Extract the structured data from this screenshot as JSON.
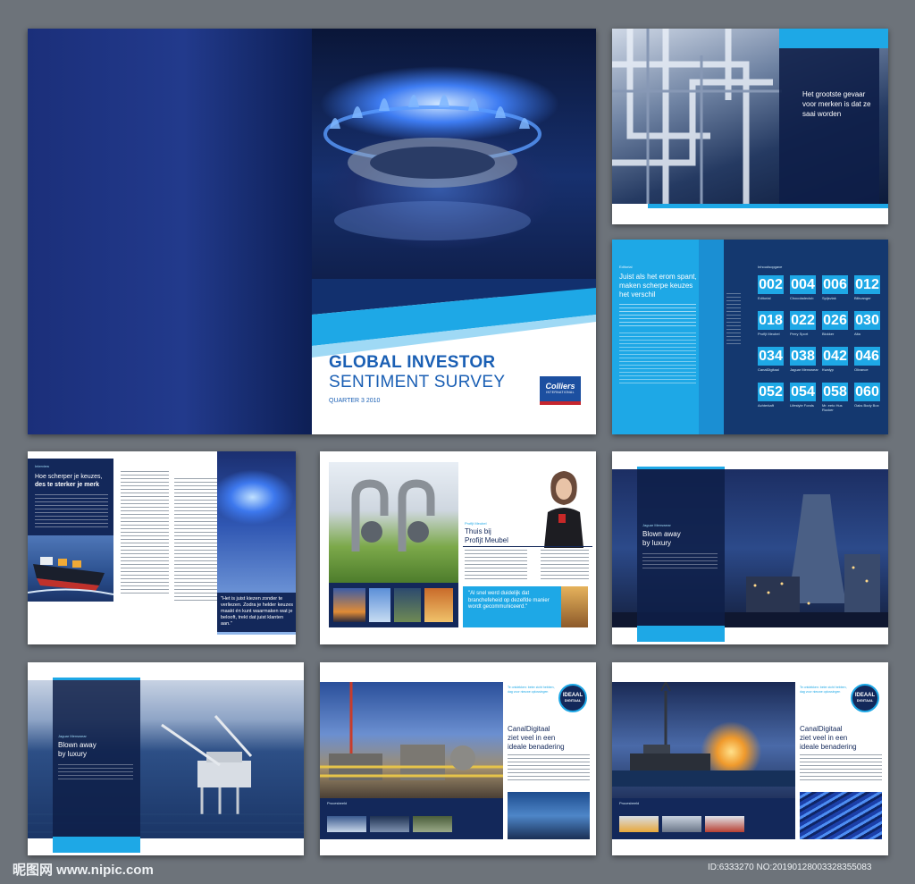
{
  "cover": {
    "title_line1": "GLOBAL INVESTOR",
    "title_line2": "SENTIMENT SURVEY",
    "quarter": "QUARTER 3 2010",
    "logo_line1": "Colliers",
    "logo_line2": "INTERNATIONAL"
  },
  "page_pipes": {
    "quote": "Het grootste gevaar voor merken is dat ze saai worden"
  },
  "page_index": {
    "intro_label": "Editorial",
    "intro_heading": "Juist als het erom spant, maken scherpe keuzes het verschil",
    "toc_label": "Inhoudsopgave",
    "toc_tiles": [
      {
        "number": "002",
        "caption": "Editorial"
      },
      {
        "number": "004",
        "caption": "Chocoladeclub"
      },
      {
        "number": "006",
        "caption": "Spijsvlak"
      },
      {
        "number": "012",
        "caption": "Blikvanger"
      },
      {
        "number": "018",
        "caption": "Profijt Meubel"
      },
      {
        "number": "022",
        "caption": "Perry Sport"
      },
      {
        "number": "026",
        "caption": "Blokker"
      },
      {
        "number": "030",
        "caption": "Alta"
      },
      {
        "number": "034",
        "caption": "CanalDigitaal"
      },
      {
        "number": "038",
        "caption": "Jaguar Menswear"
      },
      {
        "number": "042",
        "caption": "Kwalyp"
      },
      {
        "number": "046",
        "caption": "Olivance"
      },
      {
        "number": "052",
        "caption": "Achterkaft"
      },
      {
        "number": "054",
        "caption": "Lifestyle Fonds"
      },
      {
        "number": "058",
        "caption": "Mr. eeto Hus Rucker"
      },
      {
        "number": "060",
        "caption": "Oaks Body Box"
      }
    ]
  },
  "page_keuzes": {
    "label": "Interview",
    "heading_line1": "Hoe scherper je keuzes,",
    "heading_line2": "des te sterker je merk",
    "quote": "\"Het is juist kiezen zonder te verliezen. Zodra je helder keuzes maakt én kunt waarmaken wat je belooft, trekt dat juist klanten aan.\""
  },
  "page_profijt": {
    "label": "Profijt Meubel",
    "heading_line1": "Thuis bij",
    "heading_line2": "Profijt Meubel",
    "quote": "\"Al snel werd duidelijk dat branchefeheid op dezelfde manier wordt gecommuniceerd.\""
  },
  "page_blown1": {
    "label": "Jaguar Menswear",
    "heading_line1": "Blown away",
    "heading_line2": "by luxury"
  },
  "page_blown2": {
    "label": "Jaguar Menswear",
    "heading_line1": "Blown away",
    "heading_line2": "by luxury"
  },
  "page_canal1": {
    "kicker": "Te ontdekken: beter zicht hebben, dag voor nieuwe oplossingen",
    "badge_line1": "IDEAAL",
    "badge_line2": "DIGITAAL",
    "heading_line1": "CanalDigitaal",
    "heading_line2": "ziet veel in een",
    "heading_line3": "ideale benadering",
    "caption": "Procesbeeld"
  },
  "page_canal2": {
    "kicker": "Te ontdekken: beter zicht hebben, dag voor nieuwe oplossingen",
    "badge_line1": "IDEAAL",
    "badge_line2": "DIGITAAL",
    "heading_line1": "CanalDigitaal",
    "heading_line2": "ziet veel in een",
    "heading_line3": "ideale benadering",
    "caption": "Procesbeeld"
  },
  "watermark": {
    "site": "昵图网 www.nipic.com",
    "id": "ID:6333270 NO:20190128003328355083"
  },
  "colors": {
    "navy": "#0f2d6b",
    "dark_navy": "#13285a",
    "cyan": "#1ea8e6",
    "title_blue": "#1a5fb4"
  }
}
